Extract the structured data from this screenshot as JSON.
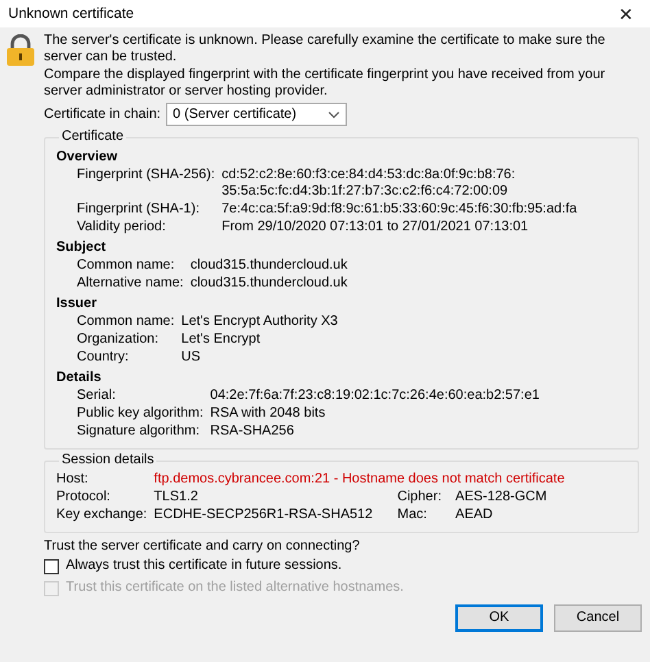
{
  "window": {
    "title": "Unknown certificate",
    "close": "✕"
  },
  "messages": [
    "The server's certificate is unknown. Please carefully examine the certificate to make sure the server can be trusted.",
    "Compare the displayed fingerprint with the certificate fingerprint you have received from your server administrator or server hosting provider."
  ],
  "chain": {
    "label": "Certificate in chain:",
    "value": "0 (Server certificate)"
  },
  "certificate": {
    "title": "Certificate",
    "sections": [
      {
        "heading": "Overview",
        "fields": [
          {
            "label": "Fingerprint (SHA-256):",
            "value": "cd:52:c2:8e:60:f3:ce:84:d4:53:dc:8a:0f:9c:b8:76:\n35:5a:5c:fc:d4:3b:1f:27:b7:3c:c2:f6:c4:72:00:09"
          },
          {
            "label": "Fingerprint (SHA-1):",
            "value": "7e:4c:ca:5f:a9:9d:f8:9c:61:b5:33:60:9c:45:f6:30:fb:95:ad:fa"
          },
          {
            "label": "Validity period:",
            "value": "From 29/10/2020 07:13:01 to 27/01/2021 07:13:01"
          }
        ]
      },
      {
        "heading": "Subject",
        "fields": [
          {
            "label": "Common name:",
            "value": "cloud315.thundercloud.uk"
          },
          {
            "label": "Alternative name:",
            "value": "cloud315.thundercloud.uk"
          }
        ]
      },
      {
        "heading": "Issuer",
        "fields": [
          {
            "label": "Common name:",
            "value": "Let's Encrypt Authority X3"
          },
          {
            "label": "Organization:",
            "value": "Let's Encrypt"
          },
          {
            "label": "Country:",
            "value": "US"
          }
        ]
      },
      {
        "heading": "Details",
        "fields": [
          {
            "label": "Serial:",
            "value": "04:2e:7f:6a:7f:23:c8:19:02:1c:7c:26:4e:60:ea:b2:57:e1"
          },
          {
            "label": "Public key algorithm:",
            "value": "RSA with 2048 bits"
          },
          {
            "label": "Signature algorithm:",
            "value": "RSA-SHA256"
          }
        ]
      }
    ]
  },
  "session": {
    "title": "Session details",
    "host": {
      "label": "Host:",
      "value": "ftp.demos.cybrancee.com:21 - Hostname does not match certificate",
      "warning": true
    },
    "rows": [
      [
        {
          "label": "Protocol:",
          "value": "TLS1.2"
        },
        {
          "label": "Cipher:",
          "value": "AES-128-GCM"
        }
      ],
      [
        {
          "label": "Key exchange:",
          "value": "ECDHE-SECP256R1-RSA-SHA512"
        },
        {
          "label": "Mac:",
          "value": "AEAD"
        }
      ]
    ]
  },
  "question": "Trust the server certificate and carry on connecting?",
  "options": [
    {
      "label": "Always trust this certificate in future sessions.",
      "checked": false,
      "disabled": false
    },
    {
      "label": "Trust this certificate on the listed alternative hostnames.",
      "checked": false,
      "disabled": true
    }
  ],
  "buttons": [
    {
      "label": "OK",
      "default": true
    },
    {
      "label": "Cancel",
      "default": false
    }
  ]
}
